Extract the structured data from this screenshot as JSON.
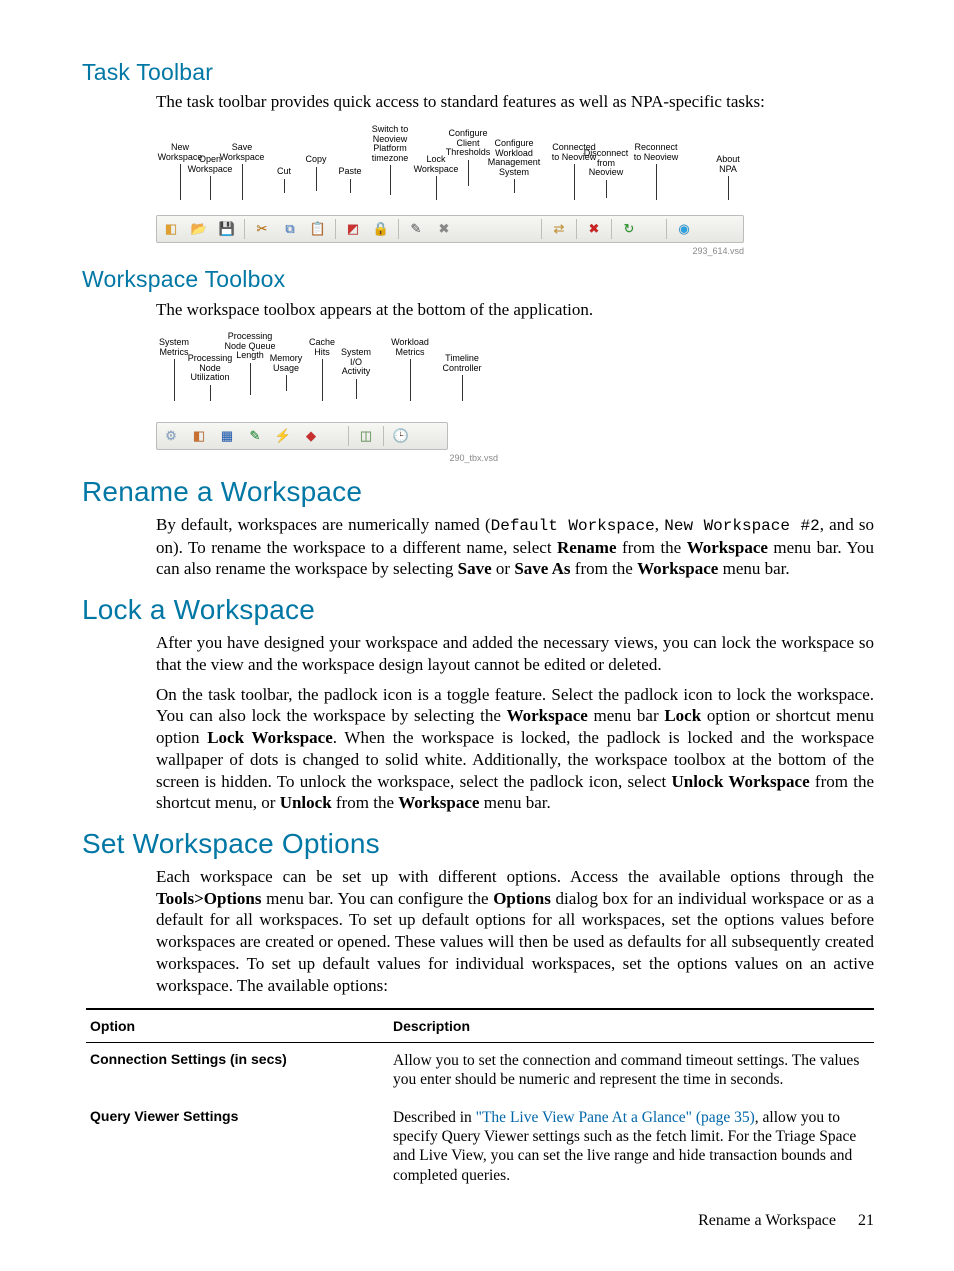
{
  "sections": {
    "task_toolbar": {
      "heading": "Task Toolbar",
      "para": "The task toolbar provides quick access to standard features as well as NPA-specific tasks:"
    },
    "workspace_toolbox": {
      "heading": "Workspace Toolbox",
      "para": "The workspace toolbox appears at the bottom of the application."
    },
    "rename": {
      "heading": "Rename a Workspace",
      "p1a": "By default, workspaces are numerically named (",
      "code1": "Default Workspace",
      "mid1": ", ",
      "code2": "New Workspace #2",
      "p1b": ", and so on). To rename the workspace to a different name, select ",
      "b1": "Rename",
      "p1c": " from the ",
      "b2": "Workspace",
      "p1d": " menu bar. You can also rename the workspace by selecting ",
      "b3": "Save",
      "p1e": " or ",
      "b4": "Save As",
      "p1f": " from the ",
      "b5": "Workspace",
      "p1g": " menu bar."
    },
    "lock": {
      "heading": "Lock a Workspace",
      "p1": "After you have designed your workspace and added the necessary views, you can lock the workspace so that the view and the workspace design layout cannot be edited or deleted.",
      "p2a": "On the task toolbar, the padlock icon is a toggle feature. Select the padlock icon to lock the workspace. You can also lock the workspace by selecting the ",
      "b1": "Workspace",
      "p2b": " menu bar ",
      "b2": "Lock",
      "p2c": " option or shortcut menu option ",
      "b3": "Lock Workspace",
      "p2d": ". When the workspace is locked, the padlock is locked and the workspace wallpaper of dots is changed to solid white. Additionally, the workspace toolbox at the bottom of the screen is hidden. To unlock the workspace, select the padlock icon, select ",
      "b4": "Unlock Workspace",
      "p2e": " from the shortcut menu, or ",
      "b5": "Unlock",
      "p2f": " from the ",
      "b6": "Workspace",
      "p2g": " menu bar."
    },
    "options": {
      "heading": "Set Workspace Options",
      "p1a": "Each workspace can be set up with different options. Access the available options through the ",
      "b1": "Tools>Options",
      "p1b": " menu bar. You can configure the ",
      "b2": "Options",
      "p1c": " dialog box for an individual workspace or as a default for all workspaces. To set up default options for all workspaces, set the options values before workspaces are created or opened. These values will then be used as defaults for all subsequently created workspaces. To set up default values for individual workspaces, set the options values on an active workspace. The available options:"
    }
  },
  "taskbar": {
    "labels": [
      "New\nWorkspace",
      "Open\nWorkspace",
      "Save\nWorkspace",
      "Cut",
      "Copy",
      "Paste",
      "Switch to\nNeoview\nPlatform\ntimezone",
      "Lock\nWorkspace",
      "Configure\nClient\nThresholds",
      "Configure\nWorkload\nManagement\nSystem",
      "Connected\nto Neoview",
      "Disconnect\nfrom\nNeoview",
      "Reconnect\nto Neoview",
      "About\nNPA"
    ],
    "caption": "293_614.vsd"
  },
  "toolbox": {
    "labels": [
      "System\nMetrics",
      "Processing\nNode\nUtilization",
      "Processing\nNode Queue\nLength",
      "Memory\nUsage",
      "Cache\nHits",
      "System\nI/O\nActivity",
      "Workload\nMetrics",
      "Timeline\nController"
    ],
    "caption": "290_tbx.vsd"
  },
  "table": {
    "head": {
      "c1": "Option",
      "c2": "Description"
    },
    "rows": [
      {
        "opt": "Connection Settings (in secs)",
        "desc_pre": "Allow you to set the connection and command timeout settings. The values you enter should be numeric and represent the time in seconds.",
        "link": "",
        "desc_post": ""
      },
      {
        "opt": "Query Viewer Settings",
        "desc_pre": "Described in ",
        "link": "\"The Live View Pane At a Glance\" (page 35)",
        "desc_post": ", allow you to specify Query Viewer settings such as the fetch limit. For the Triage Space and Live View, you can set the live range and hide transaction bounds and completed queries."
      }
    ]
  },
  "footer": {
    "title": "Rename a Workspace",
    "page": "21"
  }
}
